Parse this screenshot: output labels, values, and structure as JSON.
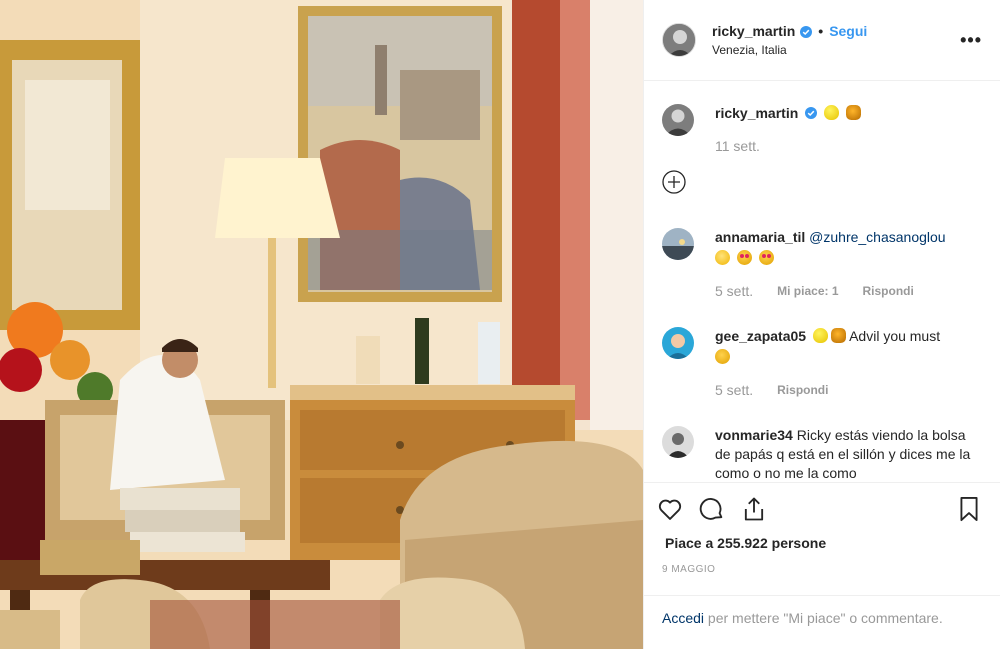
{
  "post": {
    "username": "ricky_martin",
    "follow_label": "Segui",
    "separator": "•",
    "location": "Venezia, Italia",
    "more_label": "•••"
  },
  "caption": {
    "username": "ricky_martin",
    "time": "11 sett."
  },
  "comments": [
    {
      "username": "annamaria_til",
      "mention": "@zuhre_chasanoglou",
      "time": "5 sett.",
      "likes_label": "Mi piace: 1",
      "reply_label": "Rispondi"
    },
    {
      "username": "gee_zapata05",
      "text": "Advil you must",
      "time": "5 sett.",
      "reply_label": "Rispondi"
    },
    {
      "username": "vonmarie34",
      "text": "Ricky estás viendo la bolsa de papás q está en el sillón y dices me la como o no me la como"
    }
  ],
  "likes": {
    "label": "Piace a 255.922 persone"
  },
  "date": "9 MAGGIO",
  "login": {
    "link_label": "Accedi",
    "rest": " per mettere \"Mi piace\" o commentare."
  },
  "colors": {
    "link": "#3897f0",
    "verified": "#3897f0",
    "mention": "#003569"
  },
  "icons": [
    "heart-icon",
    "comment-icon",
    "share-icon",
    "bookmark-icon",
    "add-comment-icon",
    "verified-badge-icon"
  ]
}
